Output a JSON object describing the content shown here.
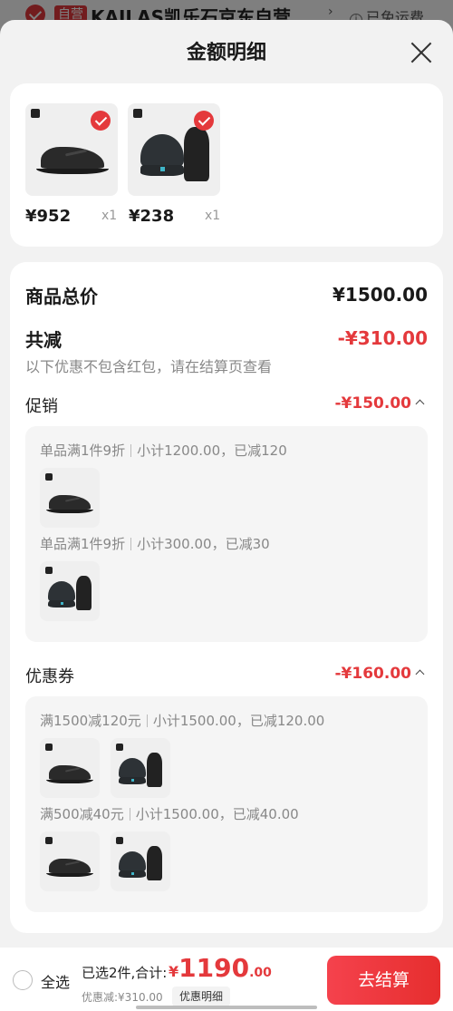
{
  "background": {
    "tag": "自营",
    "store_name": "KAILAS凯乐石京东自营",
    "arrow": "›",
    "shipping_info_icon": "i",
    "shipping": "已免运费"
  },
  "sheet": {
    "title": "金额明细"
  },
  "products": [
    {
      "price": "¥952",
      "qty": "x1",
      "icon": "shoe"
    },
    {
      "price": "¥238",
      "qty": "x1",
      "icon": "hat-glove"
    }
  ],
  "summary": {
    "total_label": "商品总价",
    "total_value": "¥1500.00",
    "reduce_label": "共减",
    "reduce_value": "-¥310.00",
    "reduce_note": "以下优惠不包含红包，请在结算页查看"
  },
  "promotion": {
    "label": "促销",
    "value": "-¥150.00",
    "rules": [
      {
        "left": "单品满1件9折",
        "right": "小计1200.00，已减120"
      },
      {
        "left": "单品满1件9折",
        "right": "小计300.00，已减30"
      }
    ]
  },
  "coupon": {
    "label": "优惠券",
    "value": "-¥160.00",
    "rules": [
      {
        "left": "满1500减120元",
        "right": "小计1500.00，已减120.00"
      },
      {
        "left": "满500减40元",
        "right": "小计1500.00，已减40.00"
      }
    ]
  },
  "bottom_bar": {
    "select_all": "全选",
    "selected": "已选2件,合计:",
    "currency": "¥",
    "amount_int": "1190",
    "amount_dec": ".00",
    "discount": "优惠减:¥310.00",
    "detail_button": "优惠明细",
    "checkout_button": "去结算"
  },
  "colors": {
    "accent": "#e4393c",
    "background": "#f2f2f2"
  }
}
